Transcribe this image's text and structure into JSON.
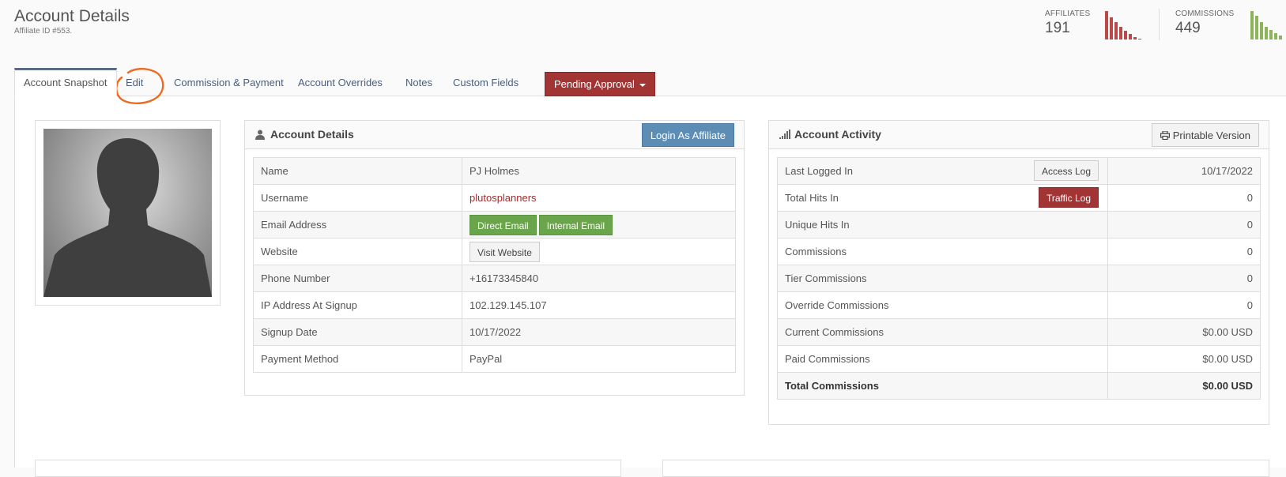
{
  "header": {
    "title": "Account Details",
    "subtitle": "Affiliate ID #553."
  },
  "stats": {
    "affiliates": {
      "label": "AFFILIATES",
      "value": "191",
      "color": "#b94a48"
    },
    "commissions": {
      "label": "COMMISSIONS",
      "value": "449",
      "color": "#8cb55a"
    }
  },
  "tabs": [
    {
      "label": "Account Snapshot",
      "active": true
    },
    {
      "label": "Edit"
    },
    {
      "label": "Commission & Payment"
    },
    {
      "label": "Account Overrides"
    },
    {
      "label": "Notes"
    },
    {
      "label": "Custom Fields"
    }
  ],
  "pending_tab": {
    "label": "Pending Approval",
    "color": "#a33434"
  },
  "details": {
    "title": "Account Details",
    "login_button": "Login As Affiliate",
    "rows": [
      {
        "key": "Name",
        "value": "PJ Holmes"
      },
      {
        "key": "Username",
        "value": "plutosplanners"
      },
      {
        "key": "Email Address",
        "btn1": "Direct Email",
        "btn2": "Internal Email"
      },
      {
        "key": "Website",
        "btn1": "Visit Website"
      },
      {
        "key": "Phone Number",
        "value": "+16173345840"
      },
      {
        "key": "IP Address At Signup",
        "value": "102.129.145.107"
      },
      {
        "key": "Signup Date",
        "value": "10/17/2022"
      },
      {
        "key": "Payment Method",
        "value": "PayPal"
      }
    ]
  },
  "activity": {
    "title": "Account Activity",
    "print_button": "Printable Version",
    "rows": [
      {
        "key": "Last Logged In",
        "btn": "Access Log",
        "value": "10/17/2022"
      },
      {
        "key": "Total Hits In",
        "btn": "Traffic Log",
        "value": "0"
      },
      {
        "key": "Unique Hits In",
        "value": "0"
      },
      {
        "key": "Commissions",
        "value": "0"
      },
      {
        "key": "Tier Commissions",
        "value": "0"
      },
      {
        "key": "Override Commissions",
        "value": "0"
      },
      {
        "key": "Current Commissions",
        "value": "$0.00 USD"
      },
      {
        "key": "Paid Commissions",
        "value": "$0.00 USD"
      },
      {
        "key": "Total Commissions",
        "value": "$0.00 USD"
      }
    ]
  },
  "annotation_color": "#ef6a21"
}
